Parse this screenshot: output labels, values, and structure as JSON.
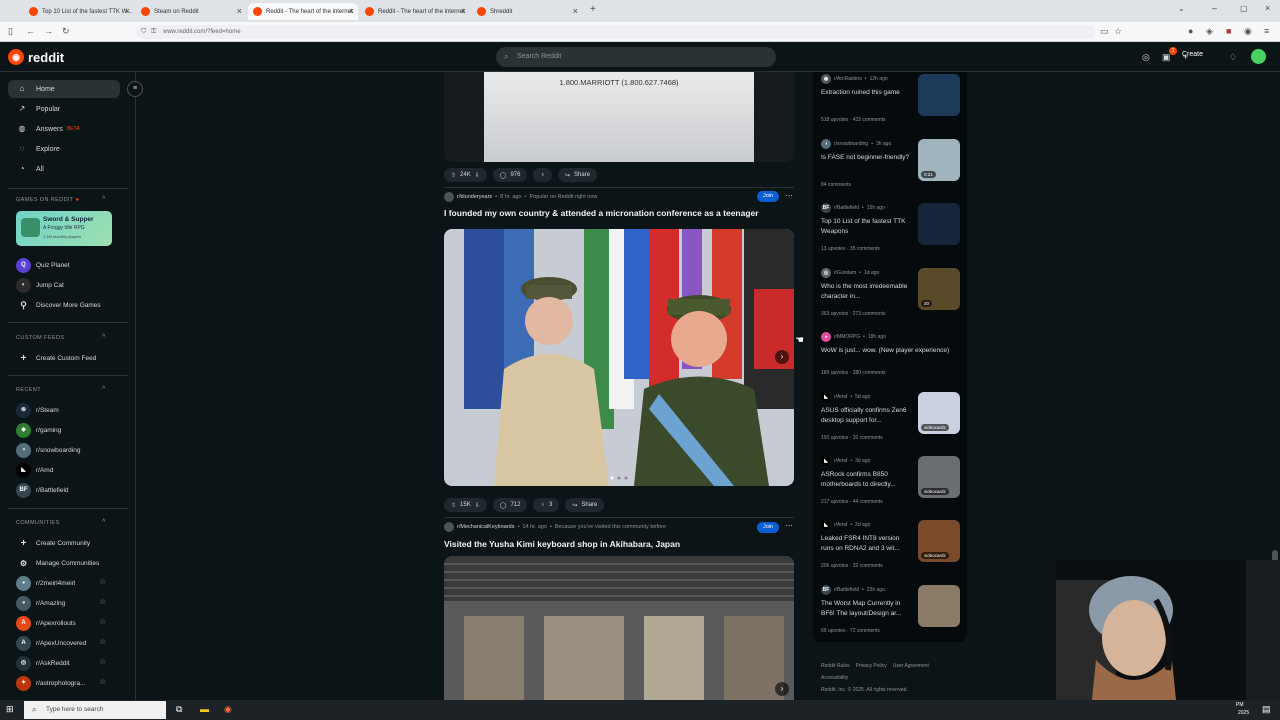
{
  "browser": {
    "tabs": [
      {
        "title": "Top 10 List of the fastest TTK W...",
        "active": false
      },
      {
        "title": "Steam on Reddit",
        "active": false
      },
      {
        "title": "Reddit - The heart of the internet",
        "active": true
      },
      {
        "title": "Reddit - The heart of the internet",
        "active": false
      },
      {
        "title": "Shreddit",
        "active": false
      }
    ],
    "new_tab": "+",
    "url": "www.reddit.com/?feed=home"
  },
  "header": {
    "logo_text": "reddit",
    "search_placeholder": "Search Reddit",
    "create_label": "Create",
    "notif_count": "1"
  },
  "leftnav": {
    "main": [
      {
        "label": "Home",
        "icon": "home-icon"
      },
      {
        "label": "Popular",
        "icon": "popular-icon"
      },
      {
        "label": "Answers",
        "icon": "answers-icon",
        "badge": "BETA"
      },
      {
        "label": "Explore",
        "icon": "explore-icon"
      },
      {
        "label": "All",
        "icon": "all-icon"
      }
    ],
    "games_title": "GAMES ON REDDIT",
    "game_card": {
      "title": "Sword & Supper",
      "subtitle": "A Froggy Idle RPG",
      "players": "1.1M monthly players"
    },
    "games": [
      {
        "label": "Quiz Planet"
      },
      {
        "label": "Jump Cat"
      },
      {
        "label": "Discover More Games"
      }
    ],
    "custom_feeds_title": "CUSTOM FEEDS",
    "create_custom_feed": "Create Custom Feed",
    "recent_title": "RECENT",
    "recent": [
      {
        "label": "r/Steam",
        "color": "#1b2838"
      },
      {
        "label": "r/gaming",
        "color": "#2e7d32"
      },
      {
        "label": "r/snowboarding",
        "color": "#546e7a"
      },
      {
        "label": "r/Amd",
        "color": "#000000"
      },
      {
        "label": "r/Battlefield",
        "color": "#37474f",
        "abbr": "BF"
      }
    ],
    "communities_title": "COMMUNITIES",
    "create_community": "Create Community",
    "manage_communities": "Manage Communities",
    "communities": [
      {
        "label": "r/2meirl4meirl",
        "color": "#607d8b"
      },
      {
        "label": "r/Amazing",
        "color": "#455a64"
      },
      {
        "label": "r/Apexrollouts",
        "color": "#e64a19"
      },
      {
        "label": "r/ApexUncovered",
        "color": "#37474f"
      },
      {
        "label": "r/AskReddit",
        "color": "#263238"
      },
      {
        "label": "r/astrophotogra...",
        "color": "#bf360c"
      }
    ]
  },
  "feed": {
    "top_post": {
      "image_text": "1.800.MARRIOTT (1.800.627.7468)",
      "upvotes": "24K",
      "comments": "976",
      "share": "Share"
    },
    "post2": {
      "subreddit": "r/blunderyears",
      "age": "8 hr. ago",
      "context": "Popular on Reddit right now",
      "join": "Join",
      "title": "I founded my own country & attended a micronation conference as a teenager",
      "upvotes": "15K",
      "comments": "712",
      "awards": "3",
      "share": "Share"
    },
    "post3": {
      "subreddit": "r/MechanicalKeyboards",
      "age": "14 hr. ago",
      "context": "Because you've visited this community before",
      "join": "Join",
      "title": "Visited the Yusha Kimi keyboard shop in Akihabara, Japan"
    }
  },
  "rightcol": {
    "items": [
      {
        "sub": "r/ArcRaiders",
        "age": "12h ago",
        "title": "Extraction ruined this game",
        "upvotes": "518 upvotes",
        "comments": "432 comments",
        "thumb": "#1e3a5a",
        "tag": ""
      },
      {
        "sub": "r/snowboarding",
        "age": "3h ago",
        "title": "Is FASE not beginner-friendly?",
        "upvotes": "",
        "comments": "84 comments",
        "thumb": "#9fb4bd",
        "tag": "0:21"
      },
      {
        "sub": "r/Battlefield",
        "age": "15h ago",
        "title": "Top 10 List of the fastest TTK Weapons",
        "upvotes": "13 upvotes",
        "comments": "35 comments",
        "thumb": "#15253a",
        "tag": ""
      },
      {
        "sub": "r/Gundam",
        "age": "1d ago",
        "title": "Who is the most irredeemable character in...",
        "upvotes": "363 upvotes",
        "comments": "273 comments",
        "thumb": "#5a4a2a",
        "tag": "20"
      },
      {
        "sub": "r/MMORPG",
        "age": "18h ago",
        "title": "WoW is just... wow. (New player experience)",
        "upvotes": "189 upvotes",
        "comments": "280 comments",
        "thumb": "",
        "tag": ""
      },
      {
        "sub": "r/Amd",
        "age": "5d ago",
        "title": "ASUS officially confirms Zen6 desktop support for...",
        "upvotes": "193 upvotes",
        "comments": "20 comments",
        "thumb": "#c9d1e0",
        "tag": "videocardz"
      },
      {
        "sub": "r/Amd",
        "age": "3d ago",
        "title": "ASRock confirms B850 motherboards to directly...",
        "upvotes": "217 upvotes",
        "comments": "44 comments",
        "thumb": "#6a6e72",
        "tag": "videocardz"
      },
      {
        "sub": "r/Amd",
        "age": "2d ago",
        "title": "Leaked FSR4 INT8 version runs on RDNA2 and 3 wit...",
        "upvotes": "206 upvotes",
        "comments": "32 comments",
        "thumb": "#7a4a2a",
        "tag": "videocardz"
      },
      {
        "sub": "r/Battlefield",
        "age": "23h ago",
        "title": "The Worst Map Currently in BF6! The layout/Design ar...",
        "upvotes": "69 upvotes",
        "comments": "72 comments",
        "thumb": "#8a7a66",
        "tag": ""
      }
    ],
    "footer": {
      "links": [
        "Reddit Rules",
        "Privacy Policy",
        "User Agreement",
        "Accessibility"
      ],
      "copyright": "Reddit, Inc. © 2025. All rights reserved."
    }
  },
  "taskbar": {
    "search_placeholder": "Type here to search",
    "clock_time": "PM",
    "clock_year": "2025"
  }
}
